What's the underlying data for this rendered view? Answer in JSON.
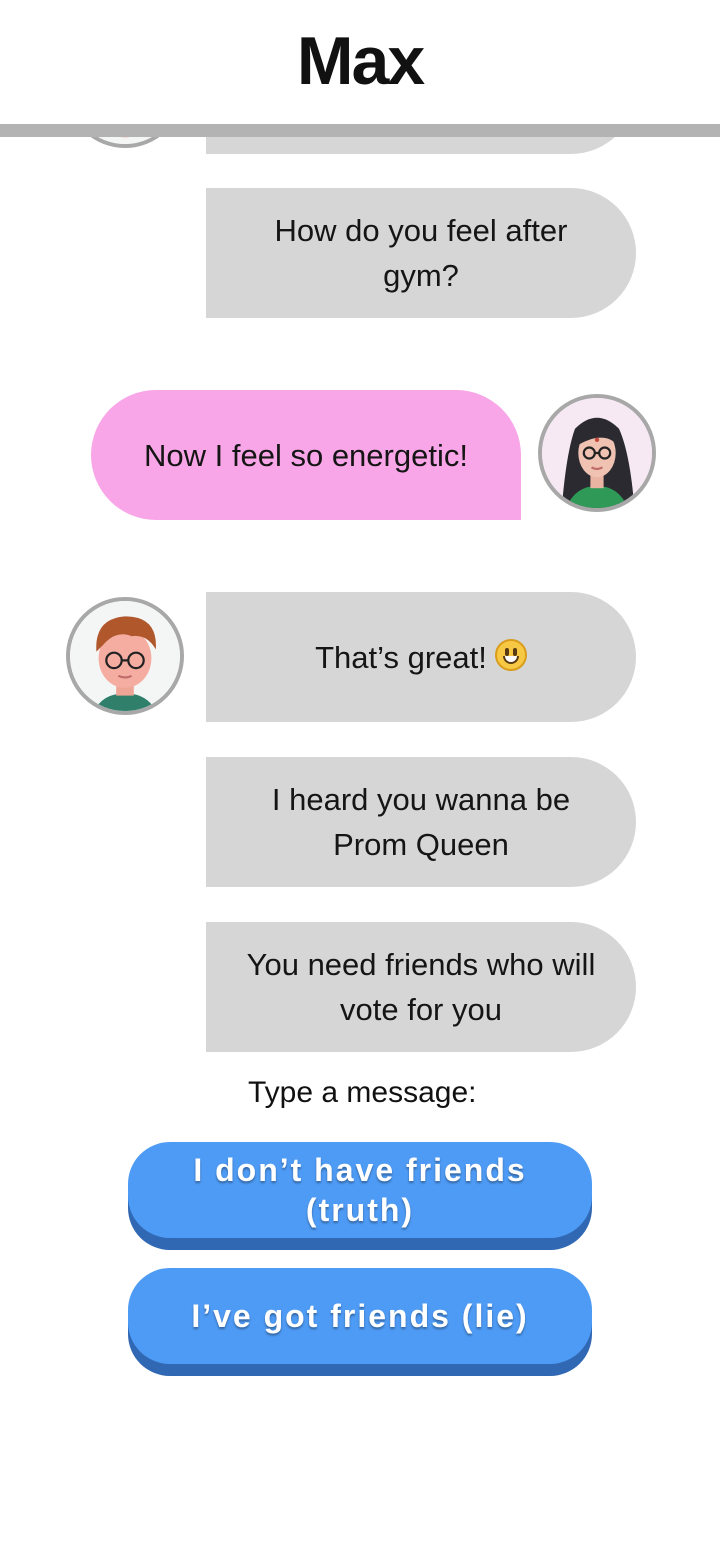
{
  "header": {
    "title": "Max"
  },
  "messages": [
    {
      "side": "incoming",
      "text": ""
    },
    {
      "side": "incoming",
      "text": "How do you feel after gym?"
    },
    {
      "side": "outgoing",
      "text": "Now I feel so energetic!"
    },
    {
      "side": "incoming",
      "text": "That’s great!",
      "emoji": "grinning-face"
    },
    {
      "side": "incoming",
      "text": "I heard you wanna be Prom Queen"
    },
    {
      "side": "incoming",
      "text": "You need friends who will vote for you"
    }
  ],
  "reply": {
    "prompt": "Type a message:",
    "options": [
      {
        "label": "I don’t have friends (truth)"
      },
      {
        "label": "I’ve got friends (lie)"
      }
    ]
  },
  "colors": {
    "incoming_bubble": "#d6d6d6",
    "outgoing_bubble": "#f9a6e8",
    "button": "#4e9bf5",
    "button_shadow": "#3168b4"
  },
  "icons": {
    "contact_avatar": "red-haired-boy-avatar",
    "user_avatar": "dark-haired-girl-avatar"
  }
}
